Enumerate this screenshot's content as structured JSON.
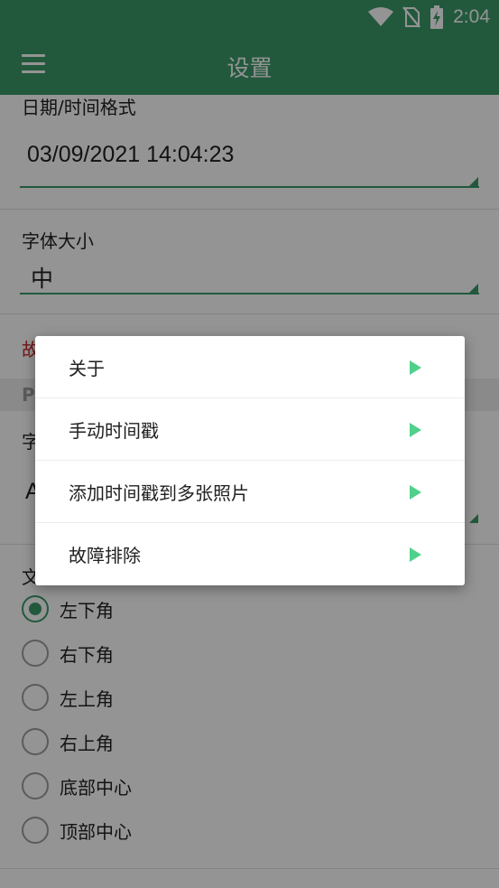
{
  "status_bar": {
    "time": "2:04",
    "icons": [
      "wifi-icon",
      "no-sim-icon",
      "battery-charging-icon"
    ]
  },
  "app_bar": {
    "title": "设置",
    "menu_icon": "hamburger-menu-icon"
  },
  "settings": {
    "date_time_format": {
      "label": "日期/时间格式",
      "value": "03/09/2021 14:04:23"
    },
    "font_size": {
      "label": "字体大小",
      "value": "中"
    },
    "partial_red_label": "故",
    "partial_section_header": "P",
    "partial_label_a": "字",
    "partial_value_a": "A",
    "partial_label_b": "文",
    "position_options": [
      {
        "label": "左下角",
        "checked": true
      },
      {
        "label": "右下角",
        "checked": false
      },
      {
        "label": "左上角",
        "checked": false
      },
      {
        "label": "右上角",
        "checked": false
      },
      {
        "label": "底部中心",
        "checked": false
      },
      {
        "label": "顶部中心",
        "checked": false
      }
    ]
  },
  "popup_menu": {
    "items": [
      {
        "label": "关于"
      },
      {
        "label": "手动时间戳"
      },
      {
        "label": "添加时间戳到多张照片"
      },
      {
        "label": "故障排除"
      }
    ]
  },
  "colors": {
    "primary": "#3b9a6a",
    "accent_arrow": "#4fd18b",
    "warning_text": "#c62828"
  }
}
